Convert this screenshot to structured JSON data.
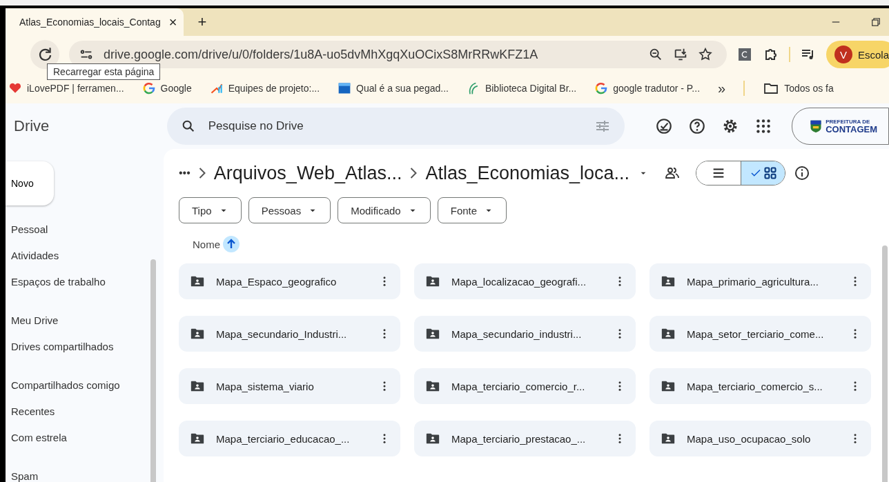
{
  "browser": {
    "tab": {
      "title": "Atlas_Economias_locais_Contag",
      "close": "×"
    },
    "new_tab": "+",
    "address": "drive.google.com/drive/u/0/folders/1u8A-uo5dvMhXgqXuOCixS8MrRRwKFZ1A",
    "tooltip": "Recarregar esta página",
    "profile": {
      "initial": "V",
      "label": "Escola"
    },
    "bookmarks": [
      {
        "label": "iLovePDF | ferramen...",
        "kind": "heart"
      },
      {
        "label": "Google",
        "kind": "google"
      },
      {
        "label": "Equipes de projeto:...",
        "kind": "chart"
      },
      {
        "label": "Qual é a sua pegad...",
        "kind": "square"
      },
      {
        "label": "Biblioteca Digital Br...",
        "kind": "leaf"
      },
      {
        "label": "google tradutor - P...",
        "kind": "google"
      }
    ],
    "bookmarks_more": "»",
    "all_bookmarks": "Todos os fa"
  },
  "drive": {
    "app_name": "Drive",
    "search": {
      "placeholder": "Pesquise no Drive"
    },
    "org_logo": {
      "line_1": "PREFEITURA DE",
      "line_2": "CONTAGEM"
    },
    "new_button": "Novo",
    "sidebar": {
      "groups": [
        [
          "Pessoal",
          "Atividades",
          "Espaços de trabalho"
        ],
        [
          "Meu Drive",
          "Drives compartilhados"
        ],
        [
          "Compartilhados comigo",
          "Recentes",
          "Com estrela"
        ],
        [
          "Spam"
        ]
      ]
    },
    "breadcrumb": {
      "more": "•••",
      "items": [
        "Arquivos_Web_Atlas...",
        "Atlas_Economias_loca..."
      ]
    },
    "view_toggle": [
      {
        "kind": "list",
        "selected": false
      },
      {
        "kind": "grid",
        "selected": true
      }
    ],
    "filters": [
      "Tipo",
      "Pessoas",
      "Modificado",
      "Fonte"
    ],
    "sort": {
      "label": "Nome"
    },
    "folders": [
      "Mapa_Espaco_geografico",
      "Mapa_localizacao_geografi...",
      "Mapa_primario_agricultura...",
      "Mapa_secundario_Industri...",
      "Mapa_secundario_industri...",
      "Mapa_setor_terciario_come...",
      "Mapa_sistema_viario",
      "Mapa_terciario_comercio_r...",
      "Mapa_terciario_comercio_s...",
      "Mapa_terciario_educacao_...",
      "Mapa_terciario_prestacao_...",
      "Mapa_uso_ocupacao_solo"
    ]
  }
}
